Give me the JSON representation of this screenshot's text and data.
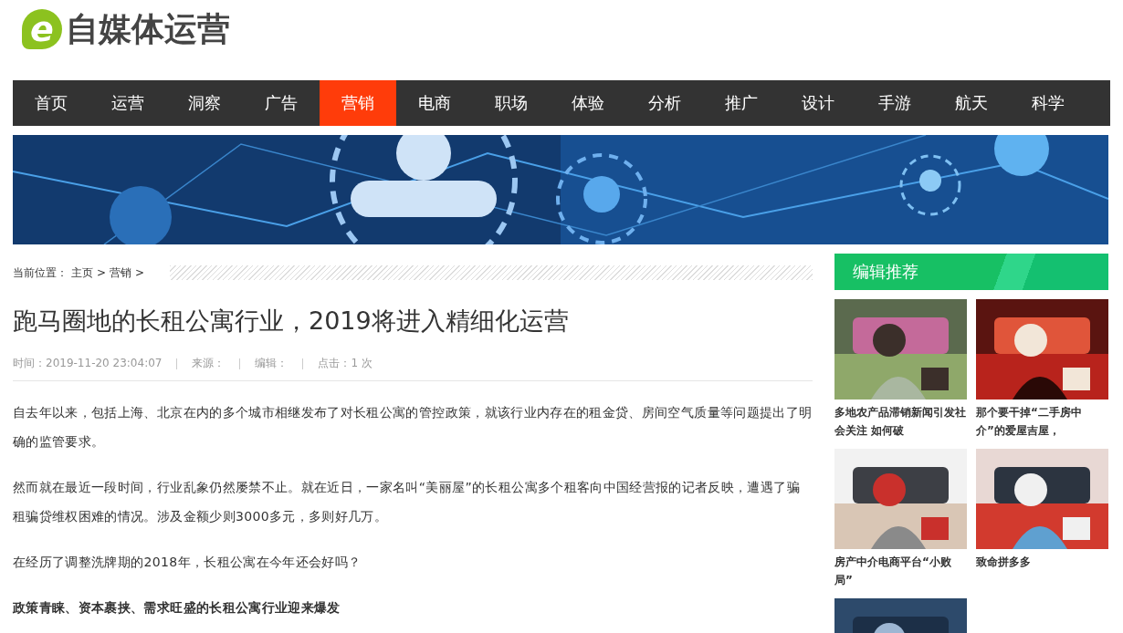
{
  "logo": {
    "mark": "e",
    "name": "自媒体运营"
  },
  "nav": [
    {
      "label": "首页",
      "selected": false
    },
    {
      "label": "运营",
      "selected": false
    },
    {
      "label": "洞察",
      "selected": false
    },
    {
      "label": "广告",
      "selected": false
    },
    {
      "label": "营销",
      "selected": true
    },
    {
      "label": "电商",
      "selected": false
    },
    {
      "label": "职场",
      "selected": false
    },
    {
      "label": "体验",
      "selected": false
    },
    {
      "label": "分析",
      "selected": false
    },
    {
      "label": "推广",
      "selected": false
    },
    {
      "label": "设计",
      "selected": false
    },
    {
      "label": "手游",
      "selected": false
    },
    {
      "label": "航天",
      "selected": false
    },
    {
      "label": "科学",
      "selected": false
    }
  ],
  "breadcrumb": {
    "label": "当前位置：",
    "items": [
      "主页",
      "营销"
    ],
    "separator": ">"
  },
  "article": {
    "title": "跑马圈地的长租公寓行业，2019将进入精细化运营",
    "meta": [
      "时间：2019-11-20 23:04:07",
      "来源：",
      "编辑：",
      "点击：1 次"
    ],
    "paragraphs": [
      {
        "kind": "text",
        "text": "自去年以来，包括上海、北京在内的多个城市相继发布了对长租公寓的管控政策，就该行业内存在的租金贷、房间空气质量等问题提出了明确的监管要求。"
      },
      {
        "kind": "text",
        "text": "然而就在最近一段时间，行业乱象仍然屡禁不止。就在近日，一家名叫“美丽屋”的长租公寓多个租客向中国经营报的记者反映，遭遇了骗租骗贷维权困难的情况。涉及金额少则3000多元，多则好几万。"
      },
      {
        "kind": "text",
        "text": "在经历了调整洗牌期的2018年，长租公寓在今年还会好吗？"
      },
      {
        "kind": "heading",
        "text": "政策青睐、资本裹挟、需求旺盛的长租公寓行业迎来爆发"
      }
    ]
  },
  "sidebar": {
    "title": "编辑推荐",
    "cards": [
      {
        "kind": "captioned",
        "title": "多地农产品滞销新闻引发社会关注 如何破"
      },
      {
        "kind": "captioned",
        "title": "那个要干掉“二手房中介”的爱屋吉屋，"
      },
      {
        "kind": "captioned",
        "title": "房产中介电商平台“小败局”"
      },
      {
        "kind": "captioned",
        "title": "致命拼多多"
      },
      {
        "kind": "picture"
      }
    ]
  }
}
